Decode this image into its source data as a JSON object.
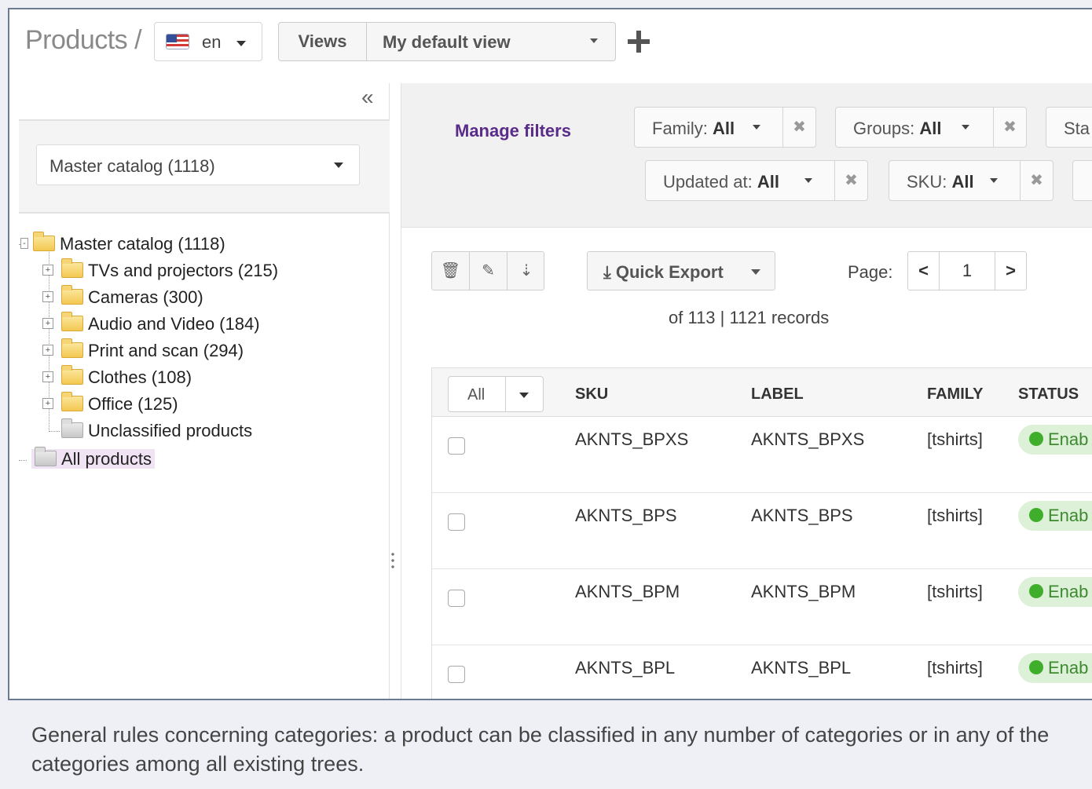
{
  "header": {
    "title": "Products /",
    "locale": "en",
    "views_label": "Views",
    "view_name": "My default view"
  },
  "sidebar": {
    "collapse_label": "«",
    "tree_select": "Master catalog (1118)",
    "tree": {
      "root": "Master catalog (1118)",
      "children": [
        "TVs and projectors (215)",
        "Cameras (300)",
        "Audio and Video (184)",
        "Print and scan (294)",
        "Clothes (108)",
        "Office (125)",
        "Unclassified products"
      ],
      "all_products": "All products"
    }
  },
  "filters": {
    "manage_label": "Manage filters",
    "items": [
      {
        "label": "Family:",
        "value": "All"
      },
      {
        "label": "Groups:",
        "value": "All"
      },
      {
        "label": "Sta",
        "value": ""
      },
      {
        "label": "Updated at:",
        "value": "All"
      },
      {
        "label": "SKU:",
        "value": "All"
      }
    ]
  },
  "toolbar": {
    "quick_export": "Quick Export",
    "page_label": "Page:",
    "page_value": "1",
    "prev": "<",
    "next": ">",
    "records": "of 113 | 1121 records"
  },
  "grid": {
    "select_all": "All",
    "columns": [
      "SKU",
      "LABEL",
      "FAMILY",
      "STATUS"
    ],
    "rows": [
      {
        "sku": "AKNTS_BPXS",
        "label": "AKNTS_BPXS",
        "family": "[tshirts]",
        "status": "Enab"
      },
      {
        "sku": "AKNTS_BPS",
        "label": "AKNTS_BPS",
        "family": "[tshirts]",
        "status": "Enab"
      },
      {
        "sku": "AKNTS_BPM",
        "label": "AKNTS_BPM",
        "family": "[tshirts]",
        "status": "Enab"
      },
      {
        "sku": "AKNTS_BPL",
        "label": "AKNTS_BPL",
        "family": "[tshirts]",
        "status": "Enab"
      }
    ]
  },
  "caption": "General rules concerning categories: a product can be classified in any number of categories or in any of the categories among all existing trees.",
  "colors": {
    "accent": "#5a2c8a",
    "status_green": "#3fae2a",
    "selected_bg": "#efe3f4"
  }
}
